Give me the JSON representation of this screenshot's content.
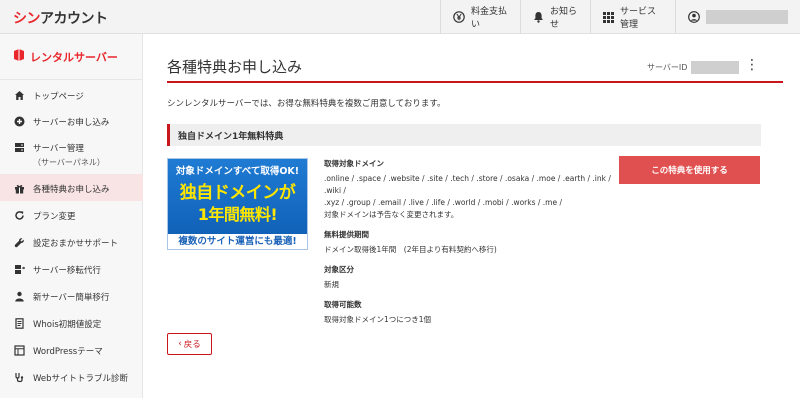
{
  "header": {
    "brand_prefix": "シン",
    "brand_suffix": "アカウント",
    "pay_label": "料金支払い",
    "news_label": "お知らせ",
    "services_label": "サービス管理"
  },
  "sidebar": {
    "title": "レンタルサーバー",
    "items": [
      {
        "label": "トップページ",
        "icon": "home-icon"
      },
      {
        "label": "サーバーお申し込み",
        "icon": "plus-circle-icon"
      },
      {
        "label": "サーバー管理",
        "sub": "（サーバーパネル）",
        "icon": "server-icon"
      },
      {
        "label": "各種特典お申し込み",
        "icon": "gift-icon",
        "active": true
      },
      {
        "label": "プラン変更",
        "icon": "refresh-icon"
      },
      {
        "label": "設定おまかせサポート",
        "icon": "wrench-icon"
      },
      {
        "label": "サーバー移転代行",
        "icon": "transfer-icon"
      },
      {
        "label": "新サーバー簡単移行",
        "icon": "person-icon"
      },
      {
        "label": "Whois初期値設定",
        "icon": "document-icon"
      },
      {
        "label": "WordPressテーマ",
        "icon": "layout-icon"
      },
      {
        "label": "Webサイトトラブル診断",
        "icon": "stethoscope-icon"
      }
    ]
  },
  "main": {
    "title": "各種特典お申し込み",
    "server_id_label": "サーバーID",
    "intro": "シンレンタルサーバーでは、お得な無料特典を複数ご用意しております。",
    "section_title": "独自ドメイン1年無料特典",
    "banner": {
      "line1": "対象ドメインすべて取得OK!",
      "line2": "独自ドメインが",
      "line3": "1年間無料!",
      "line4": "複数のサイト運営にも最適!"
    },
    "details": {
      "domains_label": "取得対象ドメイン",
      "domains_line1": ".online / .space / .website / .site / .tech / .store / .osaka / .moe / .earth / .ink / .wiki /",
      "domains_line2": ".xyz / .group / .email / .live / .life / .world / .mobi / .works / .me /",
      "domains_note": "対象ドメインは予告なく変更されます。",
      "period_label": "無料提供期間",
      "period_text": "ドメイン取得後1年間　(2年目より有料契約へ移行)",
      "type_label": "対象区分",
      "type_text": "新規",
      "count_label": "取得可能数",
      "count_text": "取得対象ドメイン1つにつき1個"
    },
    "use_button": "この特典を使用する",
    "back_button": "戻る"
  }
}
